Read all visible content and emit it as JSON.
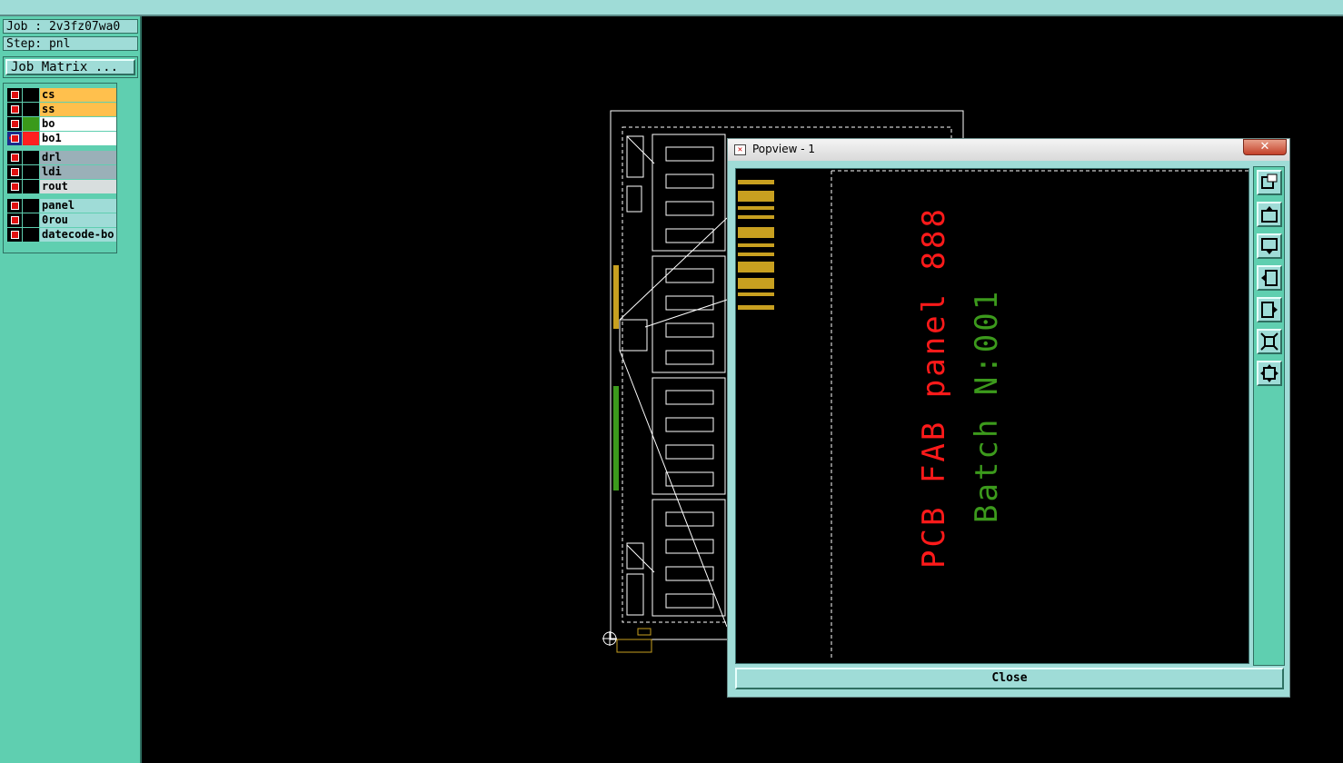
{
  "job": {
    "label": "Job : 2v3fz07wa0"
  },
  "step": {
    "label": "Step: pnl"
  },
  "job_matrix_button": "Job Matrix ...",
  "layers": [
    {
      "name": "cs",
      "color": "#ffc04d",
      "swatch": "#000000"
    },
    {
      "name": "ss",
      "color": "#ffc04d",
      "swatch": "#000000"
    },
    {
      "name": "bo",
      "color": "#ffffff",
      "swatch": "#3a9a1a"
    },
    {
      "name": "bo1",
      "color": "#ffffff",
      "swatch": "#ff2020"
    },
    {
      "name": "drl",
      "color": "#9ab0b8",
      "swatch": "#000000"
    },
    {
      "name": "ldi",
      "color": "#9ab0b8",
      "swatch": "#000000"
    },
    {
      "name": "rout",
      "color": "#d8dede",
      "swatch": "#000000"
    },
    {
      "name": "panel",
      "color": "#9fdcd7",
      "swatch": "#000000"
    },
    {
      "name": "0rou",
      "color": "#9fdcd7",
      "swatch": "#000000"
    },
    {
      "name": "datecode-bo",
      "color": "#9fdcd7",
      "swatch": "#000000"
    }
  ],
  "popup": {
    "title": "Popview - 1",
    "close_label": "Close",
    "text_red": "PCB FAB panel 888",
    "text_green": "Batch N:001",
    "red_color": "#ff1a1a",
    "green_color": "#3c9a1c"
  },
  "toolbar_icons": [
    "zoom-window-icon",
    "pan-up-icon",
    "pan-down-icon",
    "pan-left-icon",
    "pan-right-icon",
    "zoom-out-icon",
    "zoom-home-icon"
  ],
  "colors": {
    "accent": "#5fcfb0",
    "panel_bg": "#9fdcd7",
    "canvas": "#000000",
    "pad": "#c8a020"
  }
}
